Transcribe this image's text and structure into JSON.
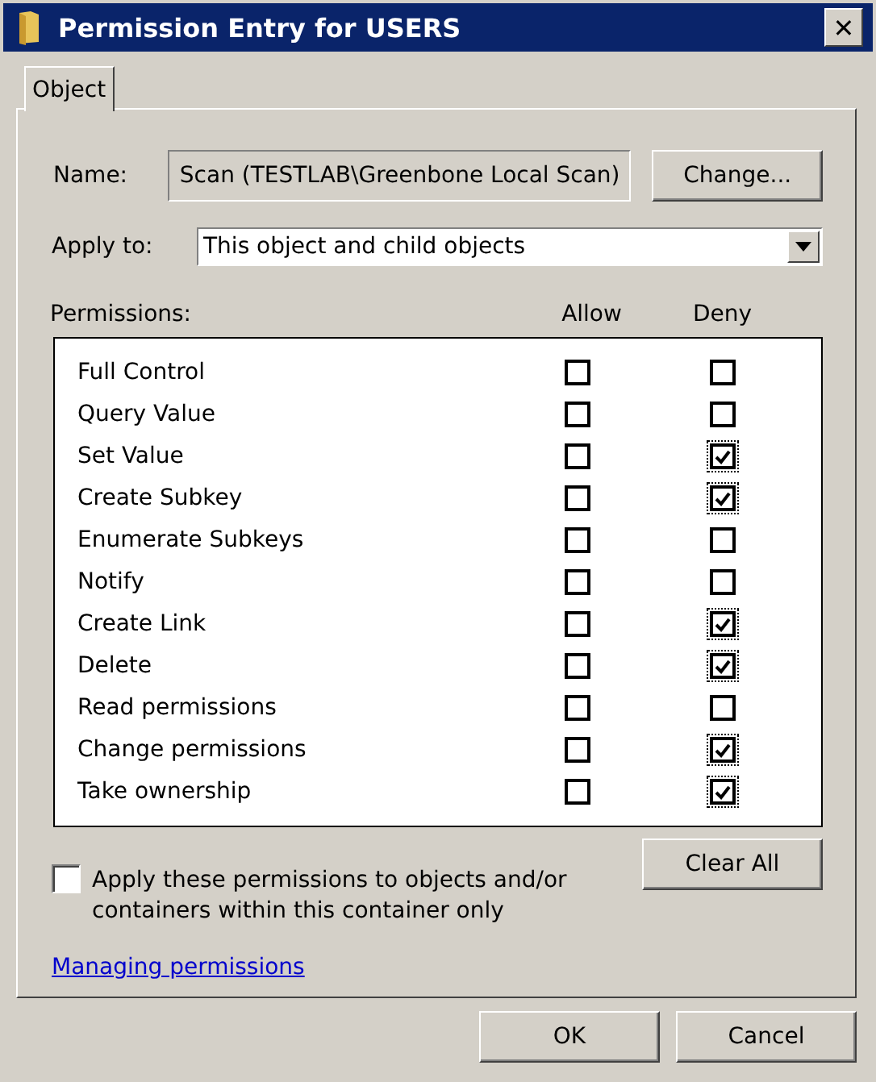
{
  "window": {
    "title": "Permission Entry for USERS",
    "close": "✕"
  },
  "tabs": [
    {
      "label": "Object",
      "selected": true
    }
  ],
  "name": {
    "label": "Name:",
    "value": "Scan (TESTLAB\\Greenbone Local Scan)",
    "button": "Change..."
  },
  "apply_to": {
    "label": "Apply to:",
    "value": "This object and child objects"
  },
  "permissions": {
    "label": "Permissions:",
    "allow_header": "Allow",
    "deny_header": "Deny",
    "rows": [
      {
        "name": "Full Control",
        "allow": false,
        "deny": false
      },
      {
        "name": "Query Value",
        "allow": false,
        "deny": false
      },
      {
        "name": "Set Value",
        "allow": false,
        "deny": true
      },
      {
        "name": "Create Subkey",
        "allow": false,
        "deny": true
      },
      {
        "name": "Enumerate Subkeys",
        "allow": false,
        "deny": false
      },
      {
        "name": "Notify",
        "allow": false,
        "deny": false
      },
      {
        "name": "Create Link",
        "allow": false,
        "deny": true
      },
      {
        "name": "Delete",
        "allow": false,
        "deny": true
      },
      {
        "name": "Read permissions",
        "allow": false,
        "deny": false
      },
      {
        "name": "Change permissions",
        "allow": false,
        "deny": true
      },
      {
        "name": "Take ownership",
        "allow": false,
        "deny": true
      }
    ]
  },
  "apply_container_only": {
    "label": "Apply these permissions to objects and/or containers within this container only",
    "checked": false
  },
  "clear_all": "Clear All",
  "link": "Managing permissions",
  "buttons": [
    "OK",
    "Cancel"
  ]
}
